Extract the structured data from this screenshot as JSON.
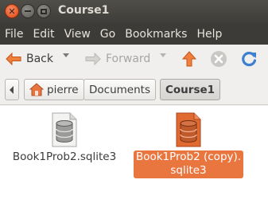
{
  "window": {
    "title": "Course1"
  },
  "menubar": {
    "items": [
      "File",
      "Edit",
      "View",
      "Go",
      "Bookmarks",
      "Help"
    ]
  },
  "toolbar": {
    "back_label": "Back",
    "forward_label": "Forward"
  },
  "pathbar": {
    "home": "pierre",
    "documents": "Documents",
    "current": "Course1"
  },
  "files": [
    {
      "name": "Book1Prob2.sqlite3",
      "icon": "sqlite-database-icon",
      "selected": false
    },
    {
      "name_line1": "Book1Prob2 (copy).",
      "name_line2": "sqlite3",
      "icon": "sqlite-database-icon",
      "selected": true
    }
  ],
  "colors": {
    "selection": "#e9753f",
    "titlebar": "#3c3b37",
    "close_button": "#df4a16"
  }
}
